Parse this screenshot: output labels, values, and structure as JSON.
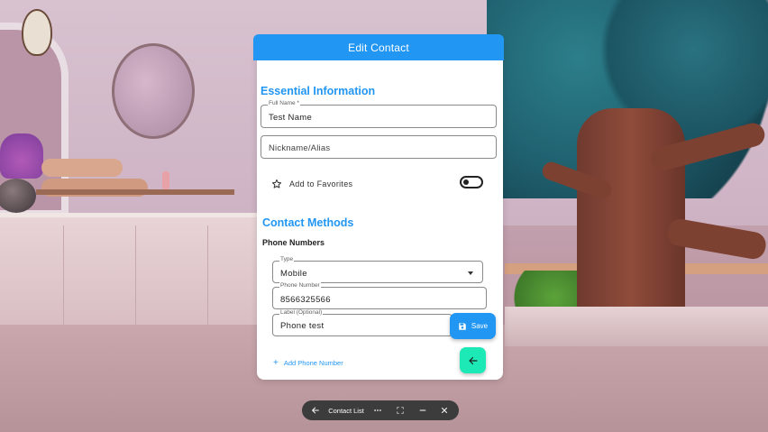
{
  "window": {
    "title": "Edit Contact"
  },
  "form": {
    "sections": {
      "essential": "Essential Information",
      "contact_methods": "Contact Methods"
    },
    "full_name": {
      "label": "Full Name *",
      "value": "Test Name"
    },
    "nickname": {
      "placeholder": "Nickname/Alias",
      "value": ""
    },
    "favorites": {
      "label": "Add to Favorites",
      "enabled": false
    },
    "phone_numbers": {
      "title": "Phone Numbers",
      "type": {
        "label": "Type",
        "value": "Mobile"
      },
      "number": {
        "label": "Phone Number",
        "value": "8566325566"
      },
      "tag": {
        "label": "Label (Optional)",
        "value": "Phone test"
      },
      "add_label": "Add Phone Number"
    },
    "save_label": "Save"
  },
  "taskbar": {
    "app_title": "Contact List"
  },
  "colors": {
    "accent": "#2196f3",
    "fab_secondary": "#1de9b6",
    "taskbar": "#3c3c3c"
  },
  "icons": [
    "star-icon",
    "floppy-disk-icon",
    "arrow-left-icon",
    "more-icon",
    "fullscreen-icon",
    "minimize-icon",
    "close-icon",
    "plus-icon"
  ]
}
